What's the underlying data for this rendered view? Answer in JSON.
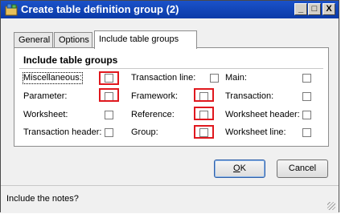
{
  "window": {
    "title": "Create table definition group (2)",
    "controls": {
      "minimize": "_",
      "maximize": "□",
      "close": "X"
    }
  },
  "tabs": [
    {
      "label": "General",
      "active": false
    },
    {
      "label": "Options",
      "active": false
    },
    {
      "label": "Include table groups",
      "active": true
    }
  ],
  "group": {
    "title": "Include table groups",
    "fields": [
      {
        "label": "Miscellaneous:",
        "checked": false,
        "highlighted": true,
        "focused": true
      },
      {
        "label": "Parameter:",
        "checked": false,
        "highlighted": true
      },
      {
        "label": "Worksheet:",
        "checked": false,
        "highlighted": false
      },
      {
        "label": "Transaction header:",
        "checked": false,
        "highlighted": false
      },
      {
        "label": "Transaction line:",
        "checked": false,
        "highlighted": false
      },
      {
        "label": "Framework:",
        "checked": false,
        "highlighted": true
      },
      {
        "label": "Reference:",
        "checked": false,
        "highlighted": true
      },
      {
        "label": "Group:",
        "checked": false,
        "highlighted": true
      },
      {
        "label": "Main:",
        "checked": false,
        "highlighted": false
      },
      {
        "label": "Transaction:",
        "checked": false,
        "highlighted": false
      },
      {
        "label": "Worksheet header:",
        "checked": false,
        "highlighted": false
      },
      {
        "label": "Worksheet line:",
        "checked": false,
        "highlighted": false
      }
    ]
  },
  "buttons": {
    "ok_mnemonic": "O",
    "ok_rest": "K",
    "cancel": "Cancel"
  },
  "status": {
    "text": "Include the notes?"
  },
  "colors": {
    "title_bar": "#0a3aa8",
    "highlight": "#e0181e"
  }
}
